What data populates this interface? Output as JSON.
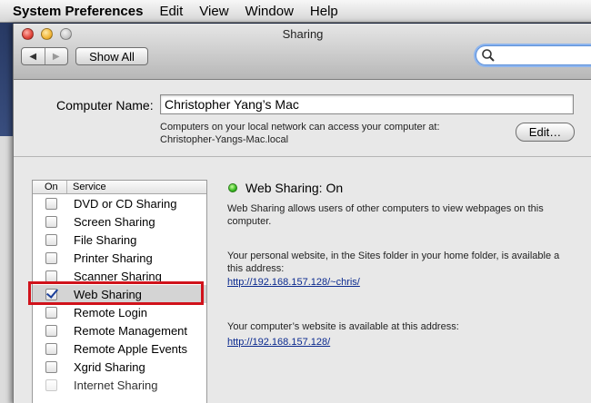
{
  "menubar": {
    "app": "System Preferences",
    "items": [
      "Edit",
      "View",
      "Window",
      "Help"
    ]
  },
  "window": {
    "title": "Sharing",
    "show_all": "Show All",
    "nav_back": "◀",
    "nav_forward": "▶",
    "search": {
      "value": "",
      "placeholder": ""
    }
  },
  "computer_name": {
    "label": "Computer Name:",
    "value": "Christopher Yang’s Mac",
    "desc_line1": "Computers on your local network can access your computer at:",
    "desc_line2": "Christopher-Yangs-Mac.local",
    "edit_button": "Edit…"
  },
  "services": {
    "header_on": "On",
    "header_service": "Service",
    "items": [
      {
        "label": "DVD or CD Sharing",
        "checked": false
      },
      {
        "label": "Screen Sharing",
        "checked": false
      },
      {
        "label": "File Sharing",
        "checked": false
      },
      {
        "label": "Printer Sharing",
        "checked": false
      },
      {
        "label": "Scanner Sharing",
        "checked": false
      },
      {
        "label": "Web Sharing",
        "checked": true,
        "selected": true
      },
      {
        "label": "Remote Login",
        "checked": false
      },
      {
        "label": "Remote Management",
        "checked": false
      },
      {
        "label": "Remote Apple Events",
        "checked": false
      },
      {
        "label": "Xgrid Sharing",
        "checked": false
      },
      {
        "label": "Internet Sharing",
        "checked": false,
        "disabled": true
      }
    ]
  },
  "detail": {
    "status": "Web Sharing: On",
    "status_color": "#35b820",
    "desc_line1": "Web Sharing allows users of other computers to view webpages on this",
    "desc_line2": "computer.",
    "personal_line1": "Your personal website, in the Sites folder in your home folder, is available a",
    "personal_line2": "this address:",
    "personal_url": "http://192.168.157.128/~chris/",
    "computer_site": "Your computer’s website is available at this address:",
    "computer_url": "http://192.168.157.128/"
  },
  "colors": {
    "highlight": "#d0121b",
    "link": "#0b2a8f"
  }
}
